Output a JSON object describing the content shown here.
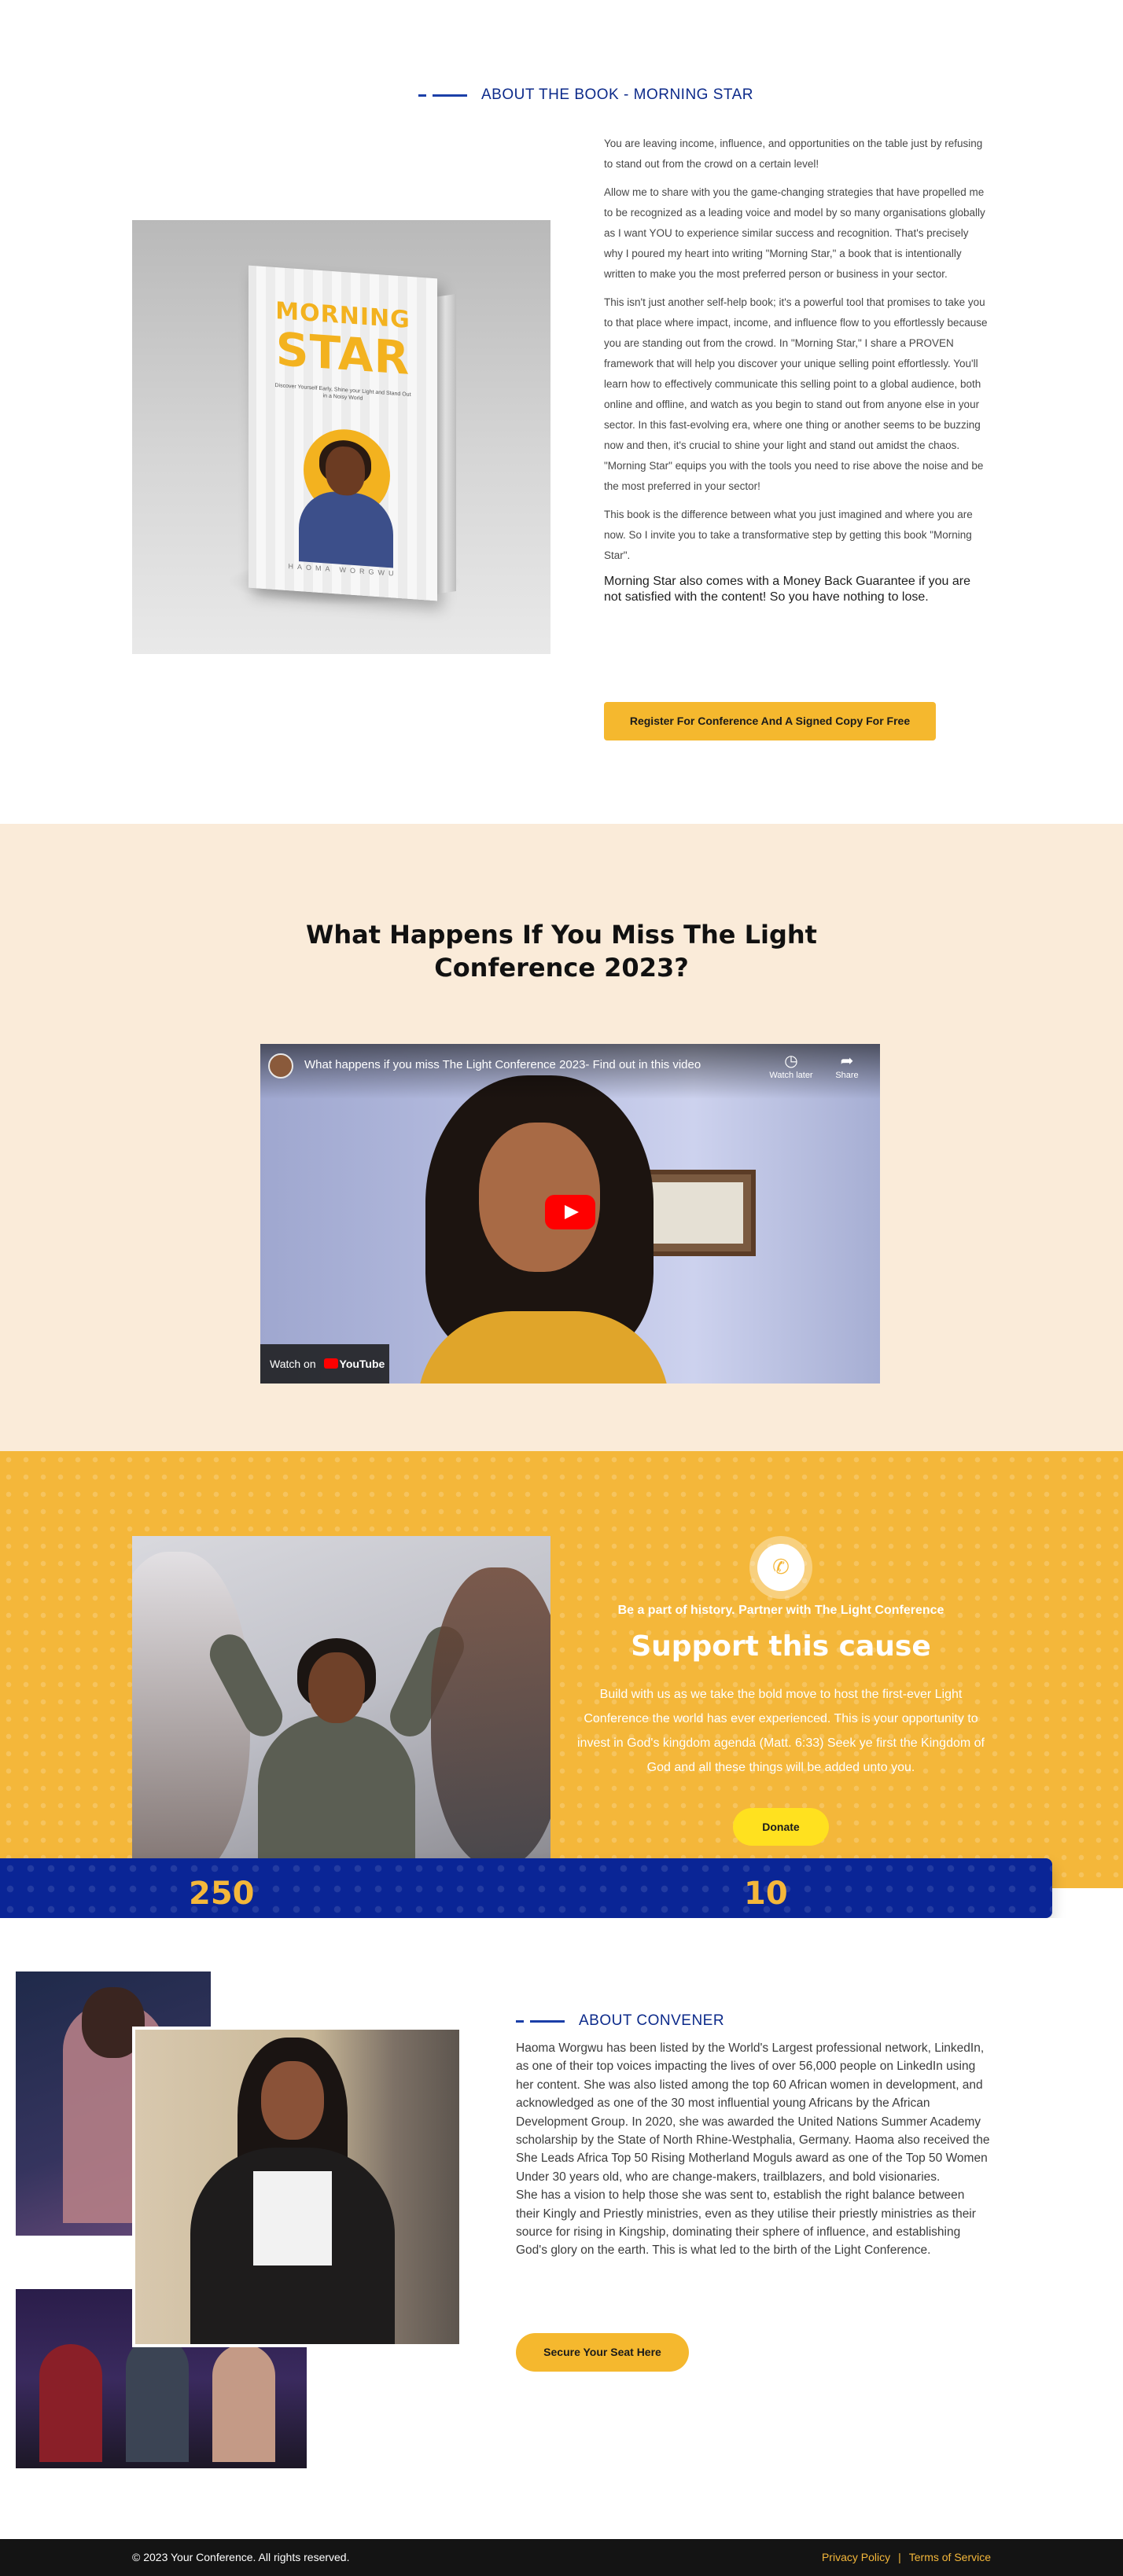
{
  "colors": {
    "primary_blue": "#0c2a8a",
    "accent_yellow": "#f5b82e",
    "cream_bg": "#faebd9",
    "cause_bg": "#f4b73a",
    "footer_bg": "#141414"
  },
  "book": {
    "tag": "ABOUT THE BOOK - MORNING STAR",
    "cover": {
      "title_line1": "MORNING",
      "title_line2": "STAR",
      "subtitle": "Discover Yourself Early, Shine your Light and Stand Out in a Noisy World",
      "author": "HAOMA WORGWU"
    },
    "paragraphs": [
      "You are leaving income, influence, and opportunities on the table just by refusing to stand out from the crowd on a certain level!",
      "Allow me to share with you the game-changing strategies that have propelled me to be recognized as a leading voice and model by so many organisations globally as I want YOU to experience similar success and recognition. That's precisely why I poured my heart into writing \"Morning Star,\" a book that is intentionally written to make you the most preferred person or business in your sector.",
      "This isn't just another self-help book; it's a powerful tool that promises to take you to that place where impact, income, and influence flow to you effortlessly because you are standing out from the crowd. In \"Morning Star,\" I share a PROVEN framework that will help you discover your unique selling point effortlessly. You'll learn how to effectively communicate this selling point to a global audience, both online and offline, and watch as you begin to stand out from anyone else in your sector. In this fast-evolving era, where one thing or another seems to be buzzing now and then, it's crucial to shine your light and stand out amidst the chaos. \"Morning Star\" equips you with the tools you need to rise above the noise and be the most preferred in your sector!",
      "This book is the difference between what you just imagined and where you are now. So I invite you to take a transformative step by getting this book \"Morning Star\"."
    ],
    "guarantee": "Morning Star also comes with a Money Back Guarantee if you are not satisfied with the content! So you have nothing to lose.",
    "cta": "Register For Conference And A Signed Copy For Free"
  },
  "video": {
    "heading": "What Happens If You Miss The Light Conference 2023?",
    "title": "What happens if you miss The Light Conference 2023- Find out in this video",
    "watch_later": "Watch later",
    "share": "Share",
    "watch_on": "Watch on",
    "youtube": "YouTube"
  },
  "cause": {
    "kicker": "Be a part of history. Partner with The Light Conference",
    "title": "Support this cause",
    "body": "Build with us as we take the bold move to host the first-ever Light Conference the world has ever experienced. This is your opportunity to invest in God's kingdom agenda (Matt. 6:33) Seek ye first the Kingdom of God and all these things will be added unto you.",
    "donate": "Donate",
    "phone_icon": "phone-icon"
  },
  "stats": {
    "values": [
      "250",
      "10"
    ]
  },
  "convener": {
    "tag": "ABOUT CONVENER",
    "paragraphs": [
      "Haoma Worgwu has been listed by the World's Largest professional network, LinkedIn, as one of their top voices impacting the lives of over 56,000 people on LinkedIn using her content. She was also listed among the top 60 African women in development, and acknowledged as one of the 30 most influential young Africans by the African Development Group. In 2020, she was awarded the United Nations Summer Academy scholarship by the State of North Rhine-Westphalia, Germany. Haoma also received the She Leads Africa Top 50 Rising Motherland Moguls award as one of the Top 50 Women Under 30 years old, who are change-makers, trailblazers, and bold visionaries.",
      "She has a vision to help those she was sent to, establish the right balance between their Kingly and Priestly ministries, even as they utilise their priestly ministries as their source for rising in Kingship, dominating their sphere of influence, and establishing God's glory on the earth. This is what led to the birth of the Light Conference."
    ],
    "cta": "Secure Your Seat Here"
  },
  "footer": {
    "copyright": "© 2023 Your Conference. All rights reserved.",
    "privacy": "Privacy Policy",
    "separator": "|",
    "terms": "Terms of Service"
  }
}
